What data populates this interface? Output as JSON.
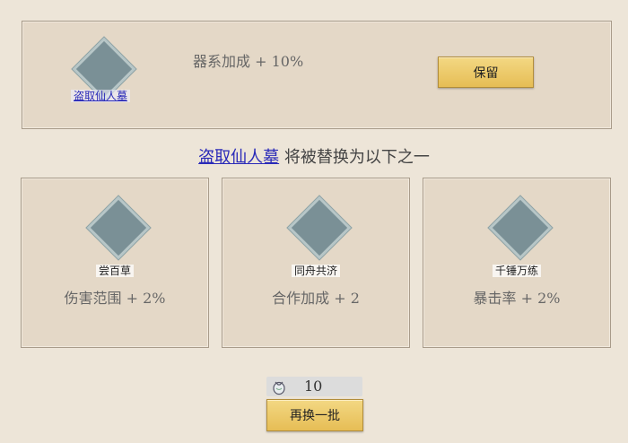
{
  "current": {
    "skill_name": "盗取仙人墓",
    "bonus": "器系加成 + 10%",
    "keep_label": "保留"
  },
  "headline": {
    "skill_link": "盗取仙人墓",
    "rest": " 将被替换为以下之一"
  },
  "options": [
    {
      "skill_name": "尝百草",
      "bonus": "伤害范围 + 2%"
    },
    {
      "skill_name": "同舟共济",
      "bonus": "合作加成 + 2"
    },
    {
      "skill_name": "千锤万练",
      "bonus": "暴击率 + 2%"
    }
  ],
  "cost": {
    "value": "10",
    "icon": "coin-pouch-icon"
  },
  "refresh_label": "再换一批",
  "colors": {
    "button": "#e6bd55",
    "skill_icon": "#7a9096",
    "link": "#2a2ab8"
  }
}
